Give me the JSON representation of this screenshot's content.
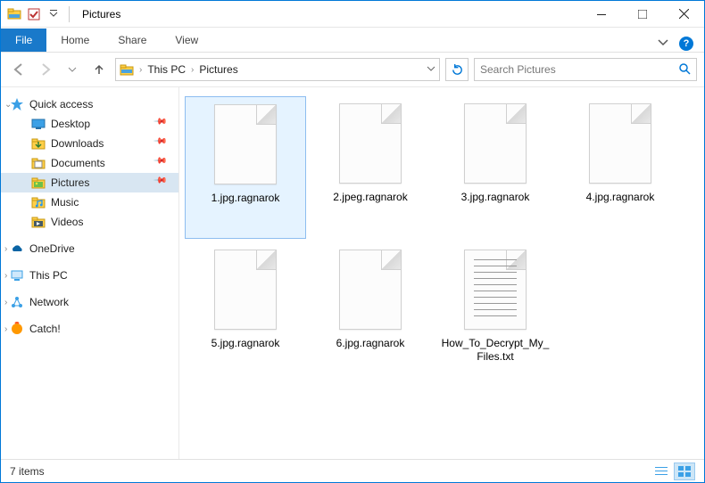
{
  "window": {
    "title": "Pictures"
  },
  "ribbon": {
    "file": "File",
    "tabs": [
      "Home",
      "Share",
      "View"
    ]
  },
  "breadcrumbs": [
    "This PC",
    "Pictures"
  ],
  "search": {
    "placeholder": "Search Pictures"
  },
  "sidebar": {
    "quick_access": {
      "label": "Quick access",
      "items": [
        {
          "label": "Desktop",
          "icon": "desktop",
          "pin": true
        },
        {
          "label": "Downloads",
          "icon": "downloads",
          "pin": true
        },
        {
          "label": "Documents",
          "icon": "documents",
          "pin": true
        },
        {
          "label": "Pictures",
          "icon": "pictures",
          "pin": true,
          "selected": true
        },
        {
          "label": "Music",
          "icon": "music",
          "pin": false
        },
        {
          "label": "Videos",
          "icon": "videos",
          "pin": false
        }
      ]
    },
    "roots": [
      {
        "label": "OneDrive",
        "icon": "onedrive"
      },
      {
        "label": "This PC",
        "icon": "thispc"
      },
      {
        "label": "Network",
        "icon": "network"
      },
      {
        "label": "Catch!",
        "icon": "catch"
      }
    ]
  },
  "files": [
    {
      "name": "1.jpg.ragnarok",
      "type": "unknown",
      "selected": true
    },
    {
      "name": "2.jpeg.ragnarok",
      "type": "unknown"
    },
    {
      "name": "3.jpg.ragnarok",
      "type": "unknown"
    },
    {
      "name": "4.jpg.ragnarok",
      "type": "unknown"
    },
    {
      "name": "5.jpg.ragnarok",
      "type": "unknown"
    },
    {
      "name": "6.jpg.ragnarok",
      "type": "unknown"
    },
    {
      "name": "How_To_Decrypt_My_Files.txt",
      "type": "txt"
    }
  ],
  "status": {
    "count_label": "7 items"
  }
}
